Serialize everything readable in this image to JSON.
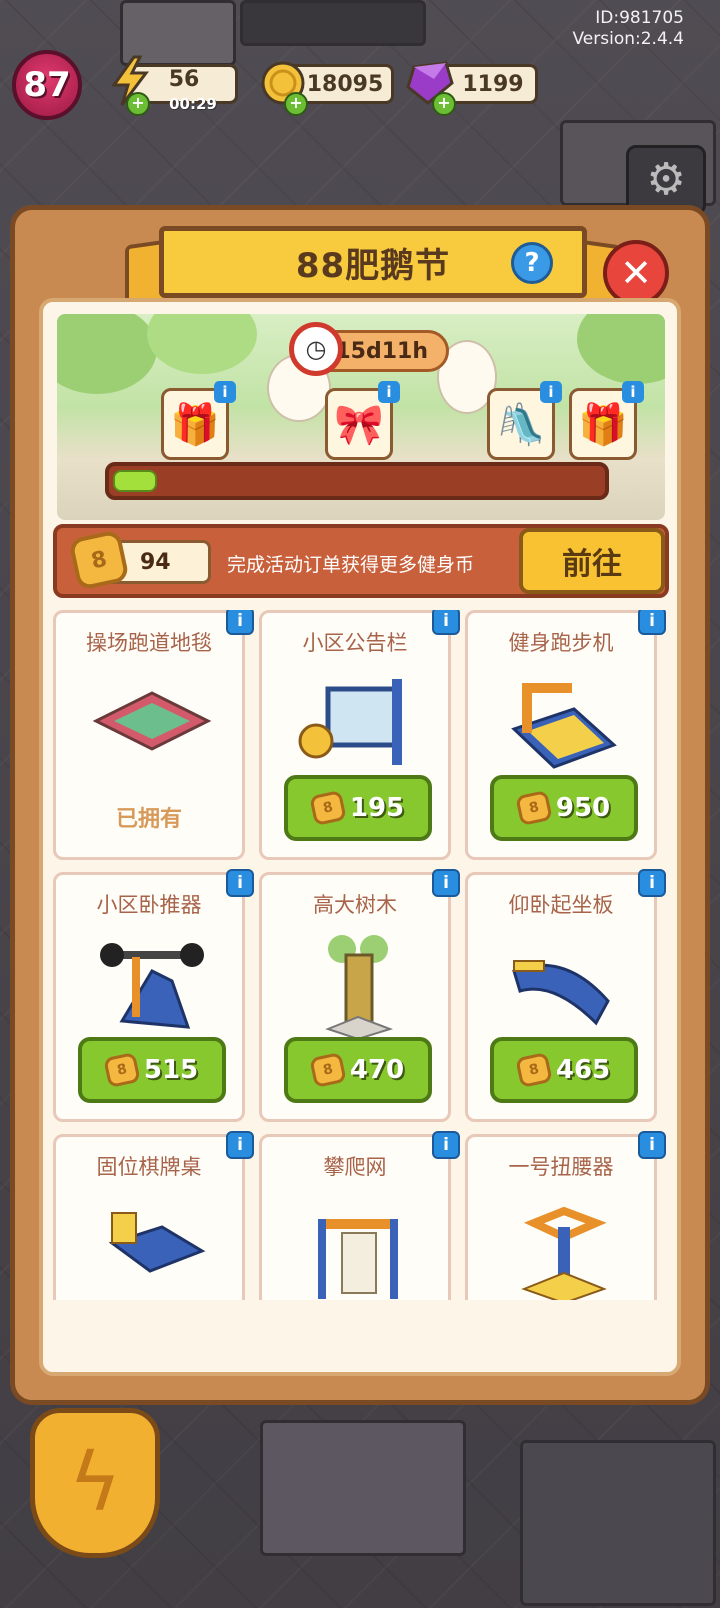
{
  "hud": {
    "id_text": "ID:981705",
    "version_text": "Version:2.4.4",
    "level": "87",
    "energy": "56",
    "energy_timer": "00:29",
    "coins": "18095",
    "gems": "1199"
  },
  "panel": {
    "title": "88肥鹅节",
    "help_label": "?",
    "close_label": "✕",
    "timer": "15d11h",
    "progress": 0.09,
    "reward_info_label": "i"
  },
  "currency": {
    "amount": "94",
    "description": "完成活动订单获得更多健身币",
    "go_label": "前往",
    "coin_symbol": "8"
  },
  "shop_items": [
    {
      "name": "操场跑道地毯",
      "status": "已拥有",
      "price": ""
    },
    {
      "name": "小区公告栏",
      "status": "",
      "price": "195"
    },
    {
      "name": "健身跑步机",
      "status": "",
      "price": "950"
    },
    {
      "name": "小区卧推器",
      "status": "",
      "price": "515"
    },
    {
      "name": "高大树木",
      "status": "",
      "price": "470"
    },
    {
      "name": "仰卧起坐板",
      "status": "",
      "price": "465"
    },
    {
      "name": "固位棋牌桌",
      "status": "",
      "price": ""
    },
    {
      "name": "攀爬网",
      "status": "",
      "price": ""
    },
    {
      "name": "一号扭腰器",
      "status": "",
      "price": ""
    }
  ],
  "colors": {
    "panel": "#c98a52",
    "ribbon": "#f8ca3e",
    "price_button": "#86c82e",
    "info_badge": "#2a8ee0",
    "close_button": "#e8453c"
  },
  "icons": {
    "energy": "lightning-icon",
    "coin": "coin-icon",
    "gem": "gem-icon",
    "settings": "gear-icon",
    "timer": "clock-icon"
  }
}
